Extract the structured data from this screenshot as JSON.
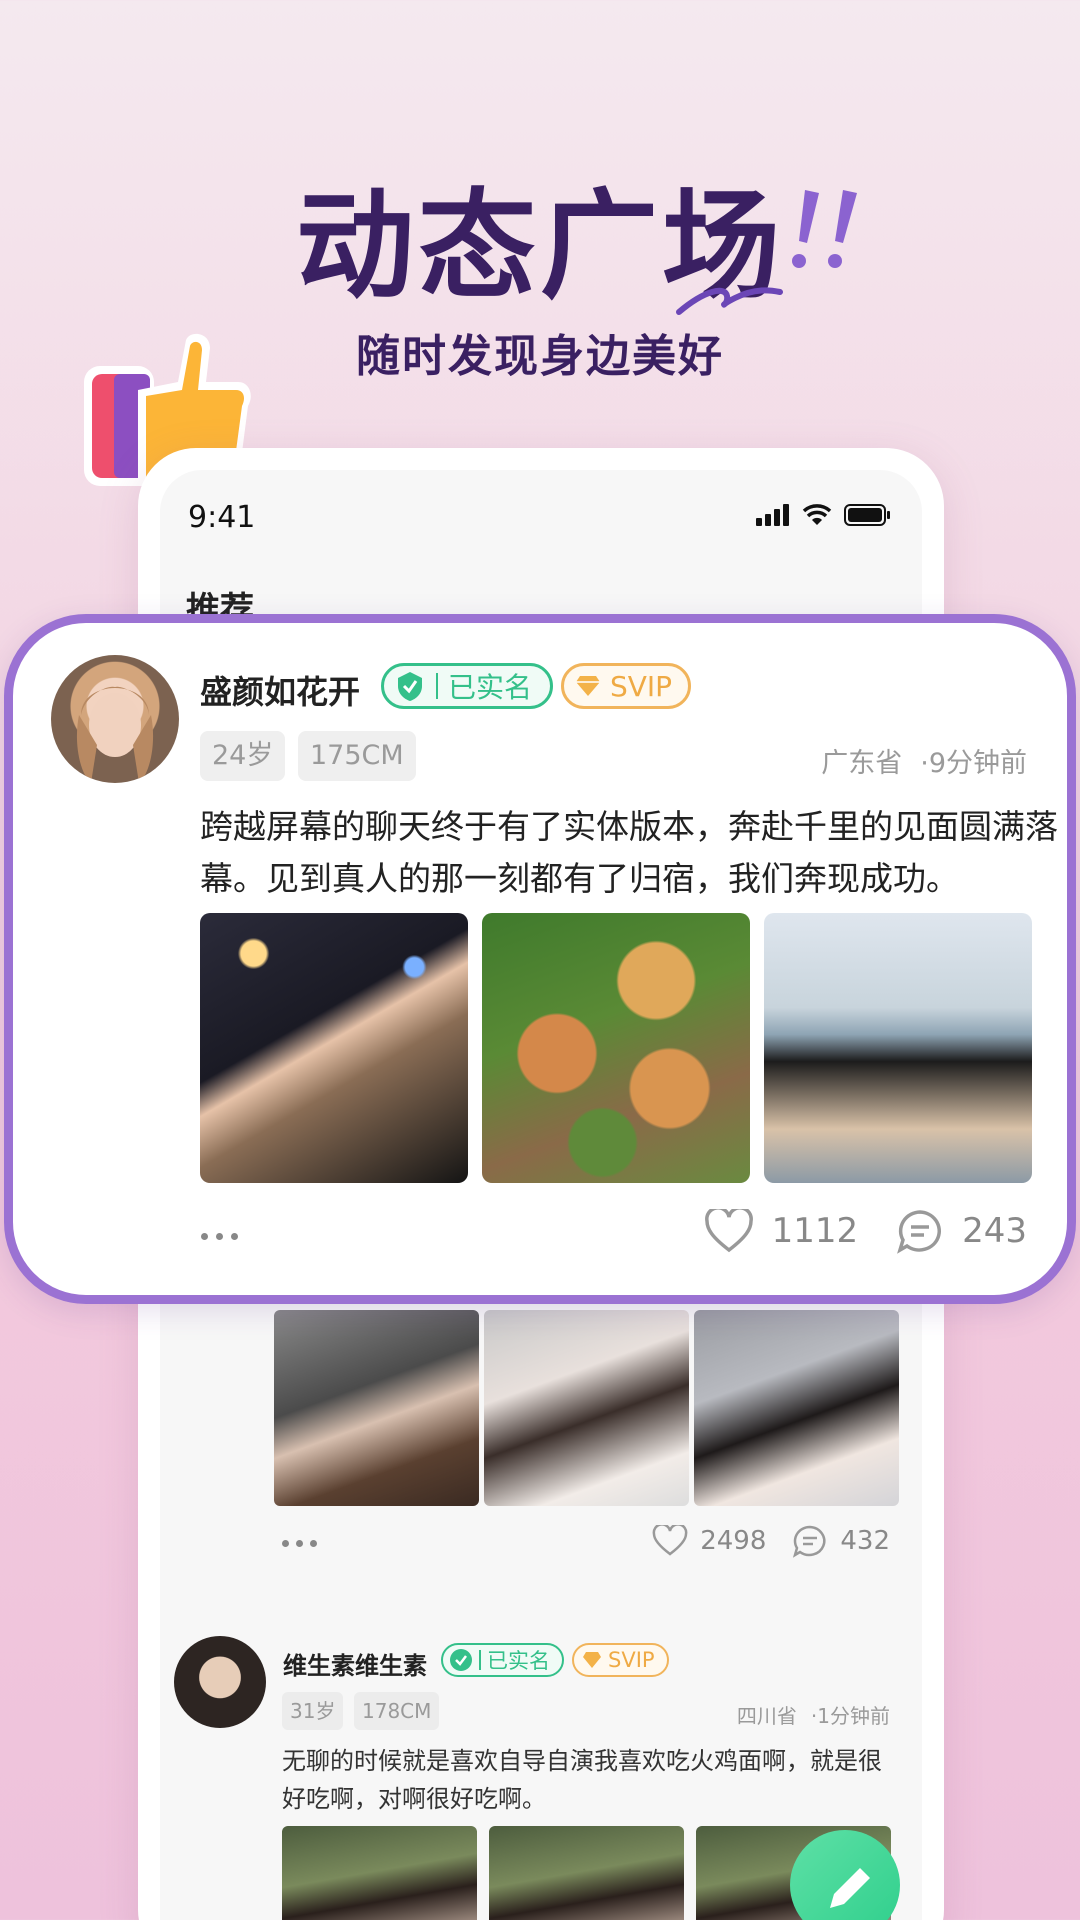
{
  "hero": {
    "title": "动态广场",
    "subtitle": "随时发现身边美好"
  },
  "status_bar": {
    "time": "9:41"
  },
  "tab": {
    "label": "推荐"
  },
  "featured_post": {
    "username": "盛颜如花开",
    "verified_label": "已实名",
    "svip_label": "SVIP",
    "age": "24岁",
    "height": "175CM",
    "location": "广东省",
    "time_ago": "·9分钟前",
    "text": "跨越屏幕的聊天终于有了实体版本，奔赴千里的见面圆满落幕。见到真人的那一刻都有了归宿，我们奔现成功。",
    "likes": "1112",
    "comments": "243"
  },
  "second_post": {
    "likes": "2498",
    "comments": "432"
  },
  "third_post": {
    "username": "维生素维生素",
    "verified_label": "已实名",
    "svip_label": "SVIP",
    "age": "31岁",
    "height": "178CM",
    "location": "四川省",
    "time_ago": "·1分钟前",
    "text": "无聊的时候就是喜欢自导自演我喜欢吃火鸡面啊，就是很好吃啊，对啊很好吃啊。"
  },
  "colors": {
    "accent_purple": "#9b72d3",
    "verified_green": "#34c08a",
    "svip_gold": "#efaa44",
    "title": "#3a2062"
  }
}
